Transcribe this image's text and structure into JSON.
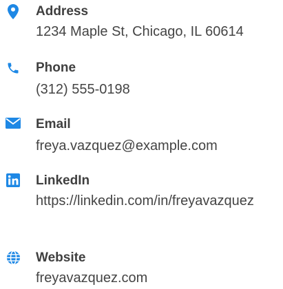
{
  "accent_color": "#1e88e5",
  "contacts": [
    {
      "icon": "map-pin-icon",
      "label": "Address",
      "value": "1234 Maple St, Chicago, IL 60614"
    },
    {
      "icon": "phone-icon",
      "label": "Phone",
      "value": "(312) 555-0198"
    },
    {
      "icon": "envelope-icon",
      "label": "Email",
      "value": "freya.vazquez@example.com"
    },
    {
      "icon": "linkedin-icon",
      "label": "LinkedIn",
      "value": "https://linkedin.com/in/freyavazquez"
    },
    {
      "icon": "globe-icon",
      "label": "Website",
      "value": "freyavazquez.com"
    }
  ]
}
